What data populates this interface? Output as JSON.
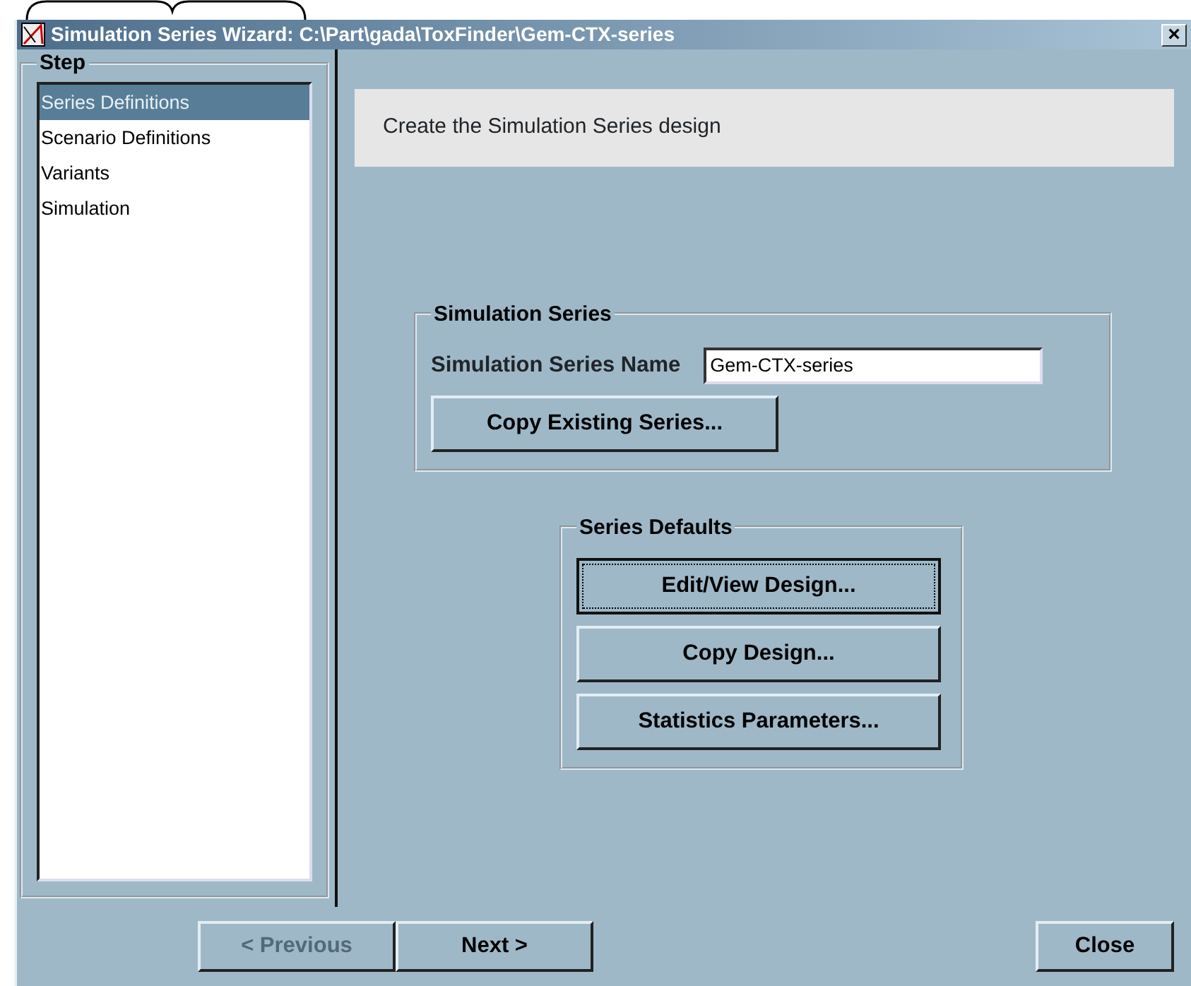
{
  "window": {
    "title": "Simulation Series Wizard: C:\\Part\\gada\\ToxFinder\\Gem-CTX-series",
    "close": "×"
  },
  "step_panel": {
    "title": "Step",
    "items": [
      {
        "label": "Series Definitions",
        "selected": true
      },
      {
        "label": "Scenario Definitions",
        "selected": false
      },
      {
        "label": "Variants",
        "selected": false
      },
      {
        "label": "Simulation",
        "selected": false
      }
    ]
  },
  "header": "Create the Simulation Series design",
  "simulation_series": {
    "title": "Simulation Series",
    "name_label": "Simulation Series Name",
    "name_value": "Gem-CTX-series",
    "copy_button": "Copy Existing Series..."
  },
  "series_defaults": {
    "title": "Series Defaults",
    "buttons": [
      {
        "label": "Edit/View Design...",
        "focused": true
      },
      {
        "label": "Copy Design...",
        "focused": false
      },
      {
        "label": "Statistics Parameters...",
        "focused": false
      }
    ]
  },
  "footer_buttons": [
    {
      "label": "< Previous",
      "disabled": true
    },
    {
      "label": "Next >",
      "disabled": false
    }
  ],
  "close_button": "Close"
}
